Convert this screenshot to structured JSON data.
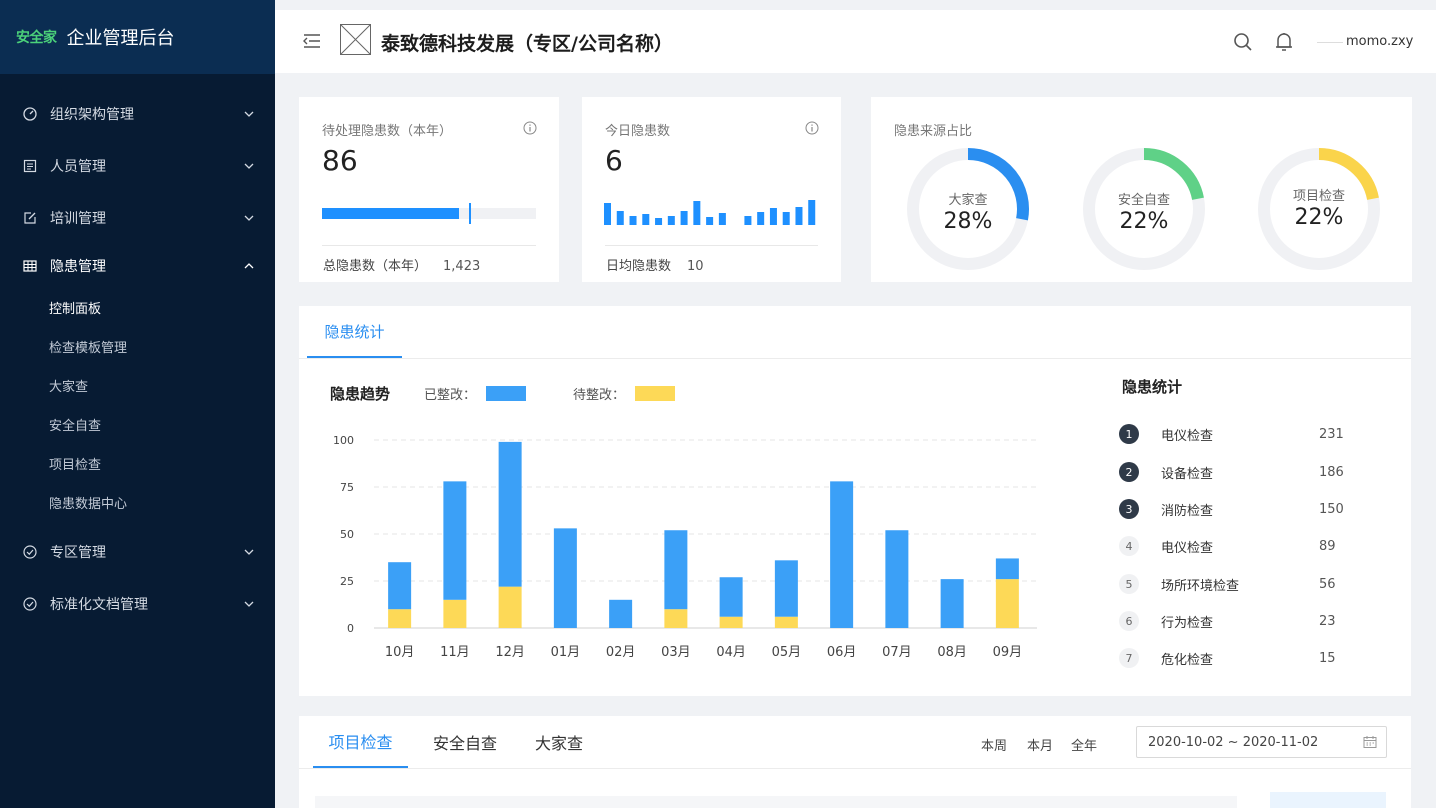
{
  "sidebar": {
    "brand_logo": "安全家",
    "brand_title": "企业管理后台",
    "menu": [
      {
        "label": "组织架构管理",
        "icon": "dashboard-gauge-icon",
        "open": false
      },
      {
        "label": "人员管理",
        "icon": "document-list-icon",
        "open": false
      },
      {
        "label": "培训管理",
        "icon": "edit-icon",
        "open": false
      },
      {
        "label": "隐患管理",
        "icon": "table-grid-icon",
        "open": true
      },
      {
        "label": "专区管理",
        "icon": "check-circle-icon",
        "open": false
      },
      {
        "label": "标准化文档管理",
        "icon": "check-circle-icon",
        "open": false
      }
    ],
    "submenu": [
      "控制面板",
      "检查模板管理",
      "大家查",
      "安全自查",
      "项目检查",
      "隐患数据中心"
    ],
    "active_sub": "控制面板"
  },
  "header": {
    "company": "泰致德科技发展（专区/公司名称）",
    "user": "momo.zxy"
  },
  "cards": {
    "pending": {
      "label": "待处理隐患数（本年）",
      "value": "86",
      "progress": 0.64,
      "foot_label": "总隐患数（本年）",
      "foot_value": "1,423"
    },
    "today": {
      "label": "今日隐患数",
      "value": "6",
      "foot_label": "日均隐患数",
      "foot_value": "10",
      "mini_bars": [
        22,
        14,
        9,
        11,
        7,
        9,
        14,
        24,
        8,
        12,
        0,
        9,
        13,
        17,
        13,
        18,
        25
      ]
    },
    "source": {
      "label": "隐患来源占比",
      "donuts": [
        {
          "name": "大家查",
          "pct": "28%",
          "value": 0.28,
          "color": "#2a8ef0"
        },
        {
          "name": "安全自查",
          "pct": "22%",
          "value": 0.22,
          "color": "#5fd187"
        },
        {
          "name": "项目检查",
          "pct": "22%",
          "value": 0.22,
          "color": "#fad44b"
        }
      ]
    }
  },
  "stats_panel": {
    "tab": "隐患统计",
    "trend_title": "隐患趋势",
    "legend_done": "已整改：",
    "legend_pending": "待整改：",
    "ranking_title": "隐患统计",
    "ranking": [
      {
        "rank": "1",
        "name": "电仪检查",
        "value": "231"
      },
      {
        "rank": "2",
        "name": "设备检查",
        "value": "186"
      },
      {
        "rank": "3",
        "name": "消防检查",
        "value": "150"
      },
      {
        "rank": "4",
        "name": "电仪检查",
        "value": "89"
      },
      {
        "rank": "5",
        "name": "场所环境检查",
        "value": "56"
      },
      {
        "rank": "6",
        "name": "行为检查",
        "value": "23"
      },
      {
        "rank": "7",
        "name": "危化检查",
        "value": "15"
      }
    ]
  },
  "chart_data": {
    "type": "bar",
    "categories": [
      "10月",
      "11月",
      "12月",
      "01月",
      "02月",
      "03月",
      "04月",
      "05月",
      "06月",
      "07月",
      "08月",
      "09月"
    ],
    "series": [
      {
        "name": "已整改",
        "values": [
          25,
          63,
          77,
          53,
          15,
          42,
          21,
          30,
          78,
          52,
          26,
          11
        ],
        "color": "#3ba0f7"
      },
      {
        "name": "待整改",
        "values": [
          10,
          15,
          22,
          0,
          0,
          10,
          6,
          6,
          0,
          0,
          0,
          26
        ],
        "color": "#fdd957"
      }
    ],
    "stacked": true,
    "ylim": [
      0,
      100
    ],
    "yticks": [
      0,
      25,
      50,
      75,
      100
    ],
    "grid": true
  },
  "bottom_panel": {
    "tabs": [
      "项目检查",
      "安全自查",
      "大家查"
    ],
    "periods": [
      "本周",
      "本月",
      "全年"
    ],
    "date_range": "2020-10-02  ~ 2020-11-02"
  }
}
